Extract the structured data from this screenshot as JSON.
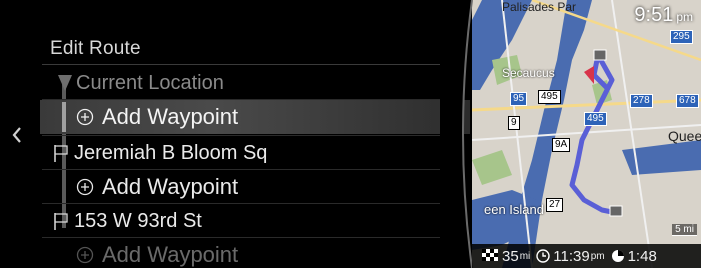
{
  "header": {
    "title": "Edit Route",
    "back_icon": "chevron-left-icon"
  },
  "route_items": [
    {
      "label": "Current Location",
      "icon": "route-start-icon",
      "type": "origin"
    },
    {
      "label": "Add Waypoint",
      "icon": "add-circle-icon",
      "type": "add",
      "selected": true
    },
    {
      "label": "Jeremiah B Bloom Sq",
      "icon": "flag-icon",
      "type": "waypoint"
    },
    {
      "label": "Add Waypoint",
      "icon": "add-circle-icon",
      "type": "add"
    },
    {
      "label": "153 W 93rd St",
      "icon": "flag-icon",
      "type": "destination"
    },
    {
      "label": "Add Waypoint",
      "icon": "add-circle-icon",
      "type": "add"
    }
  ],
  "status": {
    "clock": "9:51",
    "clock_ampm": "pm",
    "distance_value": "35",
    "distance_unit": "mi",
    "eta_value": "11:39",
    "eta_ampm": "pm",
    "duration": "1:48"
  },
  "map": {
    "labels": {
      "palisades": "Palisades Par",
      "secaucus": "Secaucus",
      "queens": "Quee",
      "island": "een Island"
    },
    "shields": [
      "295",
      "95",
      "495",
      "278",
      "678",
      "9",
      "495",
      "9A",
      "27"
    ],
    "scale": "5 mi",
    "colors": {
      "route": "#5a5fd6",
      "water": "#3d5fa8",
      "land": "#d9d4cc"
    }
  }
}
